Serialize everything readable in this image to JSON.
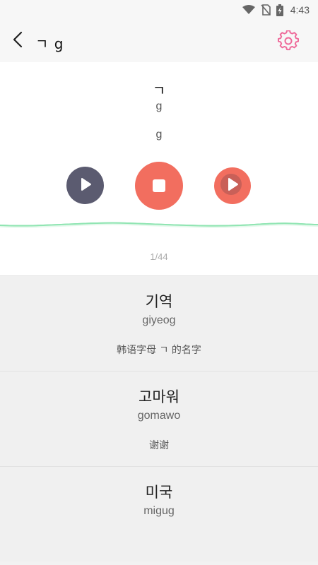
{
  "status_bar": {
    "time": "4:43"
  },
  "app_bar": {
    "title": "ㄱ g"
  },
  "player": {
    "letter": "ㄱ",
    "romanization": "g",
    "pronunciation": "g",
    "progress": "1/44"
  },
  "words": [
    {
      "hangul": "기역",
      "roman": "giyeog",
      "meaning": "韩语字母 ㄱ 的名字"
    },
    {
      "hangul": "고마워",
      "roman": "gomawo",
      "meaning": "谢谢"
    },
    {
      "hangul": "미국",
      "roman": "migug",
      "meaning": ""
    }
  ],
  "colors": {
    "accent_pink": "#ef6a9a",
    "record_red": "#f26e5f",
    "play_dark": "#5b5b70",
    "wave_green": "#2ecc71"
  },
  "icons": {
    "status": [
      "wifi-icon",
      "no-sim-icon",
      "battery-charging-icon"
    ],
    "app_bar": [
      "back-arrow-icon",
      "gear-icon"
    ],
    "player": [
      "play-icon",
      "stop-icon",
      "play-icon"
    ]
  }
}
